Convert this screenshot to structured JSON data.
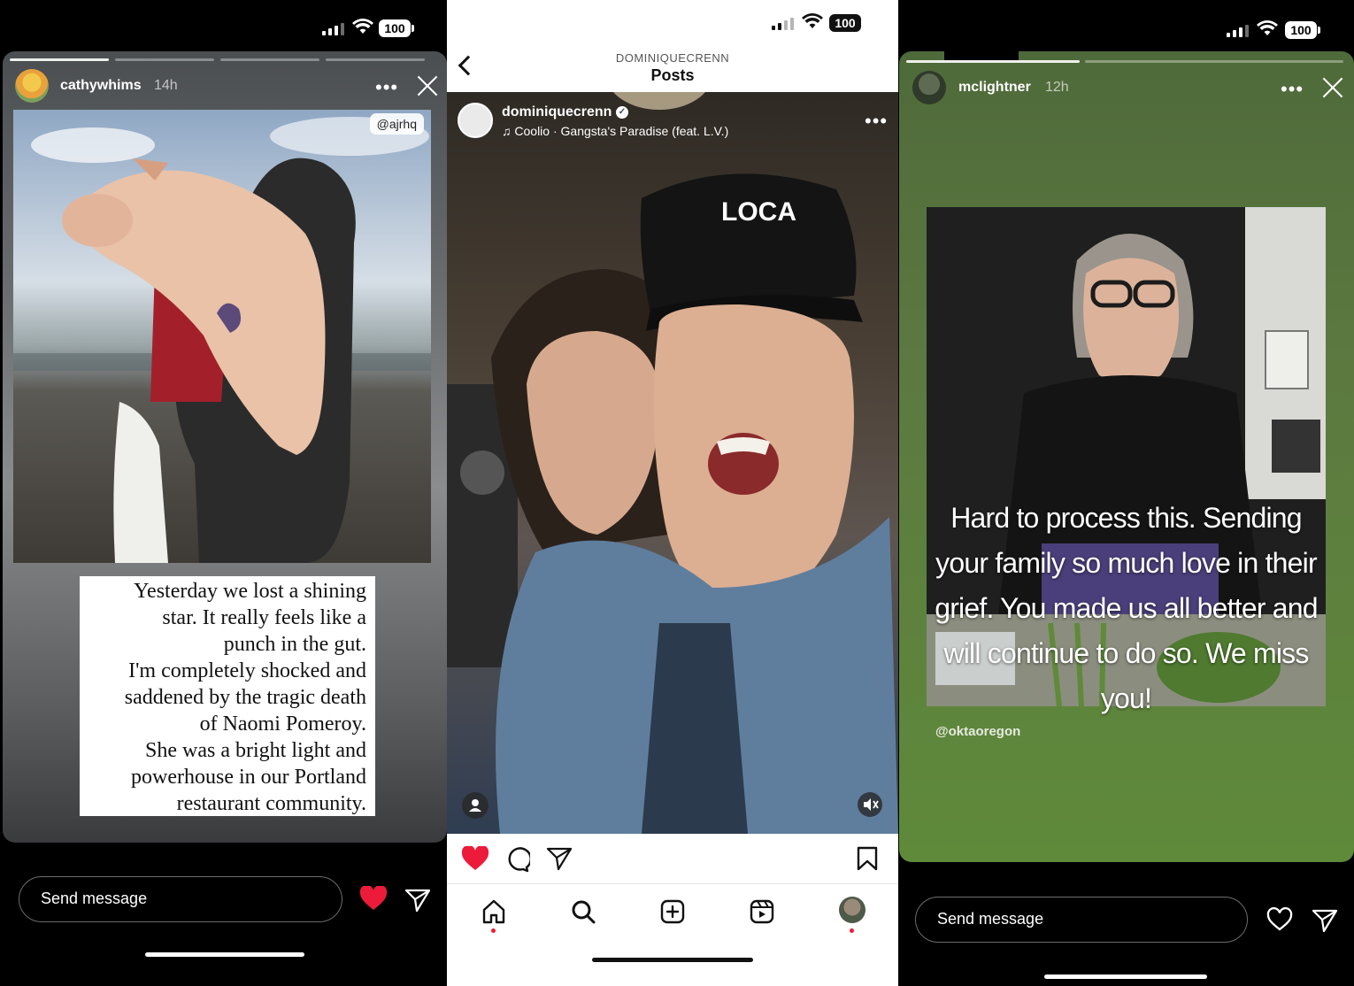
{
  "status_bar": {
    "battery": "100"
  },
  "story_left": {
    "username": "cathywhims",
    "time": "14h",
    "photo_tag": "@ajrhq",
    "quote_lines": [
      "Yesterday we lost a shining",
      "star. It really feels like a",
      "punch in the gut.",
      "I'm completely shocked and",
      "saddened by the tragic death",
      "of Naomi Pomeroy.",
      "She was a bright light and",
      "powerhouse in our Portland",
      "restaurant community."
    ],
    "send_placeholder": "Send message"
  },
  "post_middle": {
    "header_account": "DOMINIQUECRENN",
    "header_title": "Posts",
    "username": "dominiquecrenn",
    "music": "Coolio · Gangsta's Paradise (feat. L.V.)",
    "cap_text": "LOCA"
  },
  "story_right": {
    "username": "mclightner",
    "time": "12h",
    "overlay_lines": [
      "Hard to process this. Sending",
      "your family so much love in their",
      "grief. You made us all better and",
      "will continue to do so. We miss",
      "you!"
    ],
    "mention": "@oktaoregon",
    "send_placeholder": "Send message"
  },
  "colors": {
    "like_red": "#ed1b3a",
    "story_green": "#5c7a40",
    "story_gray": "#5e6164"
  }
}
